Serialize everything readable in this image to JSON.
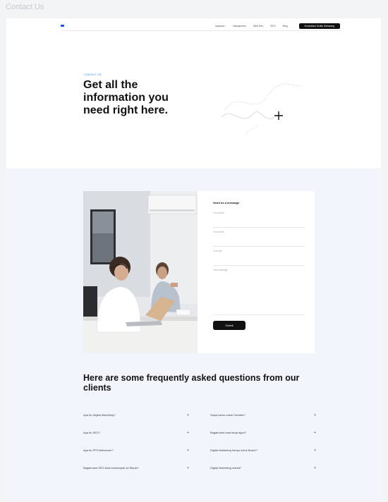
{
  "caption": "Contact Us",
  "nav": {
    "logo_mark": "",
    "logo_text": "",
    "links": [
      {
        "label": "Layanan",
        "has_chevron": true
      },
      {
        "label": "Manajemen",
        "has_chevron": false
      },
      {
        "label": "Web Dev",
        "has_chevron": false
      },
      {
        "label": "SEO",
        "has_chevron": false
      },
      {
        "label": "Blog",
        "has_chevron": false
      }
    ],
    "cta_label": "Konsultasi Gratis Sekarang"
  },
  "hero": {
    "tag": "CONTACT US",
    "title": "Get all the information you need right here."
  },
  "contact": {
    "form_title": "Send us a message",
    "fields": [
      {
        "placeholder": "Your name"
      },
      {
        "placeholder": "Your email"
      },
      {
        "placeholder": "Your site"
      }
    ],
    "message_placeholder": "Your message",
    "submit_label": "Submit"
  },
  "faq": {
    "title": "Here are some frequently asked questions from our clients",
    "items": [
      {
        "question": "Apa itu Digital Marketing?"
      },
      {
        "question": "Siapa kamu untuk Gambar?"
      },
      {
        "question": "Apa itu SEO?"
      },
      {
        "question": "Bagaimana cara kerja agen?"
      },
      {
        "question": "Apa itu PPC/Influencer?"
      },
      {
        "question": "Digital Marketing hanya untuk Brand?"
      },
      {
        "question": "Bagaimana SEO bisa berdampak ke Bisnis?"
      },
      {
        "question": "Digital Marketing mahal?"
      }
    ]
  },
  "colors": {
    "accent": "#1d4ed8",
    "tag_blue": "#3b82f6",
    "button_dark": "#111111",
    "section_bg": "#f2f6fc"
  }
}
